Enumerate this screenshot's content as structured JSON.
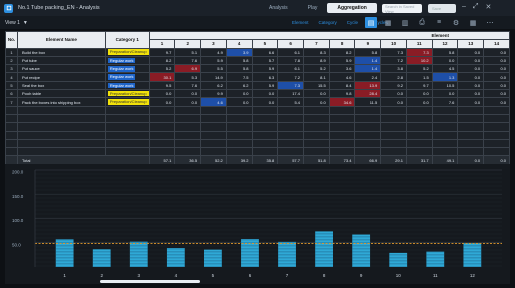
{
  "titlebar": {
    "title": "No.1 Tube packing_EN - Analysis"
  },
  "nav": {
    "tabs": [
      "Analysis",
      "Play",
      "Aggregation"
    ],
    "active": "Aggregation"
  },
  "search": {
    "placeholder": "Search in Saved View"
  },
  "save": {
    "label": "Save"
  },
  "view": {
    "label": "View 1"
  },
  "filters": [
    "Element",
    "Category",
    "Cycle",
    "All Cycles"
  ],
  "table": {
    "headers": {
      "no": "No.",
      "element": "Element Name",
      "category": "Category 1",
      "element_group": "Element"
    },
    "cycle_columns": [
      "1",
      "2",
      "3",
      "4",
      "5",
      "6",
      "7",
      "8",
      "9",
      "10",
      "11",
      "12",
      "13",
      "14"
    ],
    "rows": [
      {
        "no": "1",
        "name": "Build the box",
        "cat": "Preparation/Cleanup",
        "cat_type": "prep",
        "vals": [
          "9.7",
          "5.1",
          "4.9",
          "3.9",
          "6.6",
          "6.1",
          "8.3",
          "8.2",
          "5.8",
          "7.3",
          "7.3",
          "5.8",
          "0.0",
          "0.0"
        ],
        "colors": {
          "4": "blue",
          "11": "red"
        }
      },
      {
        "no": "2",
        "name": "Put tube",
        "cat": "Regular work",
        "cat_type": "reg",
        "vals": [
          "8.2",
          "7.6",
          "5.9",
          "5.8",
          "5.7",
          "7.8",
          "8.9",
          "5.9",
          "1.4",
          "7.2",
          "10.2",
          "0.0",
          "0.0",
          "0.0"
        ],
        "colors": {
          "9": "blue",
          "11": "red"
        }
      },
      {
        "no": "3",
        "name": "Put sauce",
        "cat": "Regular work",
        "cat_type": "reg",
        "vals": [
          "5.2",
          "6.9",
          "5.5",
          "5.8",
          "5.9",
          "6.1",
          "5.2",
          "3.6",
          "1.4",
          "3.8",
          "5.2",
          "4.5",
          "0.0",
          "0.0"
        ],
        "colors": {
          "2": "red",
          "9": "blue"
        }
      },
      {
        "no": "4",
        "name": "Put recipe",
        "cat": "Regular work",
        "cat_type": "reg",
        "vals": [
          "30.1",
          "5.3",
          "14.9",
          "7.5",
          "6.3",
          "7.2",
          "8.1",
          "4.6",
          "2.4",
          "2.8",
          "1.5",
          "1.3",
          "0.0",
          "0.0"
        ],
        "colors": {
          "1": "red",
          "12": "blue"
        }
      },
      {
        "no": "5",
        "name": "Seal the box",
        "cat": "Regular work",
        "cat_type": "reg",
        "vals": [
          "9.5",
          "7.6",
          "6.2",
          "6.2",
          "5.9",
          "7.3",
          "15.5",
          "8.4",
          "13.9",
          "9.2",
          "9.7",
          "10.5",
          "0.0",
          "0.0"
        ],
        "colors": {
          "6": "blue",
          "9": "red"
        }
      },
      {
        "no": "6",
        "name": "Pooh table",
        "cat": "Preparation/Cleanup",
        "cat_type": "prep",
        "vals": [
          "0.0",
          "0.0",
          "9.9",
          "0.0",
          "0.0",
          "17.4",
          "0.0",
          "9.8",
          "28.4",
          "0.0",
          "0.0",
          "0.0",
          "0.0",
          "0.0"
        ],
        "colors": {
          "9": "red"
        }
      },
      {
        "no": "7",
        "name": "Pack the boxes into shipping box",
        "cat": "Preparation/Cleanup",
        "cat_type": "prep",
        "vals": [
          "0.0",
          "0.0",
          "4.6",
          "0.0",
          "0.0",
          "5.4",
          "0.0",
          "34.6",
          "11.5",
          "0.0",
          "0.0",
          "7.6",
          "0.0",
          "0.0"
        ],
        "colors": {
          "3": "blue",
          "8": "red"
        }
      }
    ],
    "total": {
      "label": "Total",
      "vals": [
        "57.1",
        "36.5",
        "52.2",
        "39.2",
        "35.8",
        "57.7",
        "51.8",
        "73.4",
        "66.9",
        "29.1",
        "31.7",
        "49.1",
        "0.0",
        "0.0"
      ],
      "colors": {
        "8": "red",
        "10": "blue"
      }
    }
  },
  "chart_data": {
    "type": "bar",
    "categories": [
      "1",
      "2",
      "3",
      "4",
      "5",
      "6",
      "7",
      "8",
      "9",
      "10",
      "11",
      "12"
    ],
    "series": [
      {
        "values": [
          57.1,
          36.5,
          52.2,
          39.2,
          35.8,
          57.7,
          51.8,
          73.4,
          66.9,
          29.1,
          31.7,
          49.1
        ]
      }
    ],
    "y_ticks": [
      "200.0",
      "150.0",
      "100.0",
      "50.0"
    ],
    "ylim": [
      0,
      200
    ],
    "average": 48.3,
    "colors": {
      "bar": "#2fa9d6",
      "bar_dark": "#1b5f86",
      "average_line": "#e39a2b"
    }
  }
}
